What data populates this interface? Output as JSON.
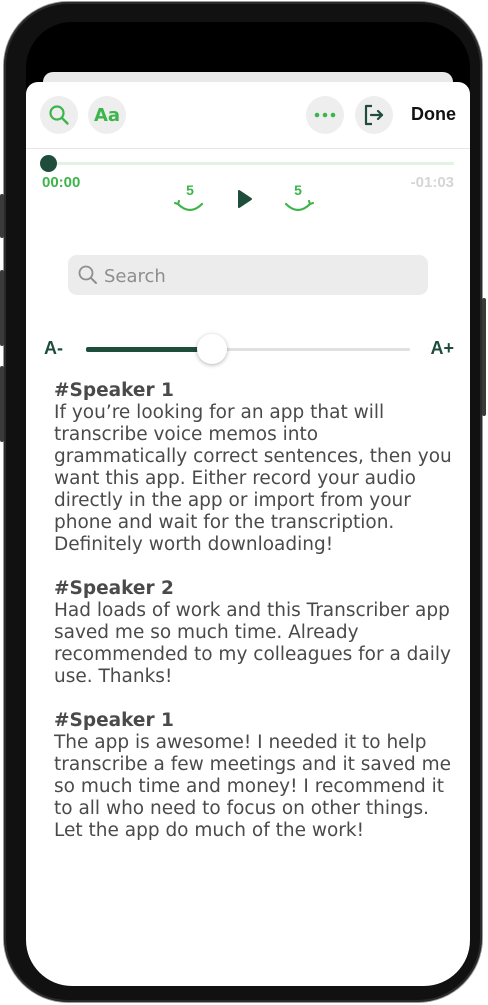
{
  "toolbar": {
    "font_label": "Aa",
    "done_label": "Done",
    "accent": "#3cb54a",
    "dark_accent": "#1f4d3c"
  },
  "player": {
    "current_time": "00:00",
    "remaining_time": "-01:03",
    "skip_back_seconds": "5",
    "skip_forward_seconds": "5",
    "progress": 0
  },
  "search": {
    "placeholder": "Search"
  },
  "font_size": {
    "decrease_label": "A-",
    "increase_label": "A+",
    "level": 0.39
  },
  "transcript": [
    {
      "speaker": "#Speaker 1",
      "text": "If you’re looking for an app that will transcribe voice memos into grammatically correct sentences, then you want this app. Either record your audio directly in the app or import from your phone and wait for the transcription. Definitely worth downloading!"
    },
    {
      "speaker": "#Speaker 2",
      "text": "Had loads of work and this Transcriber app saved me so much time. Already recommended to my colleagues for a daily use. Thanks!"
    },
    {
      "speaker": "#Speaker 1",
      "text": "The app is awesome! I needed it to help transcribe a few meetings and it saved me so much time and money! I recommend it to all who need to focus on other things. Let the app do much of the work!"
    }
  ]
}
